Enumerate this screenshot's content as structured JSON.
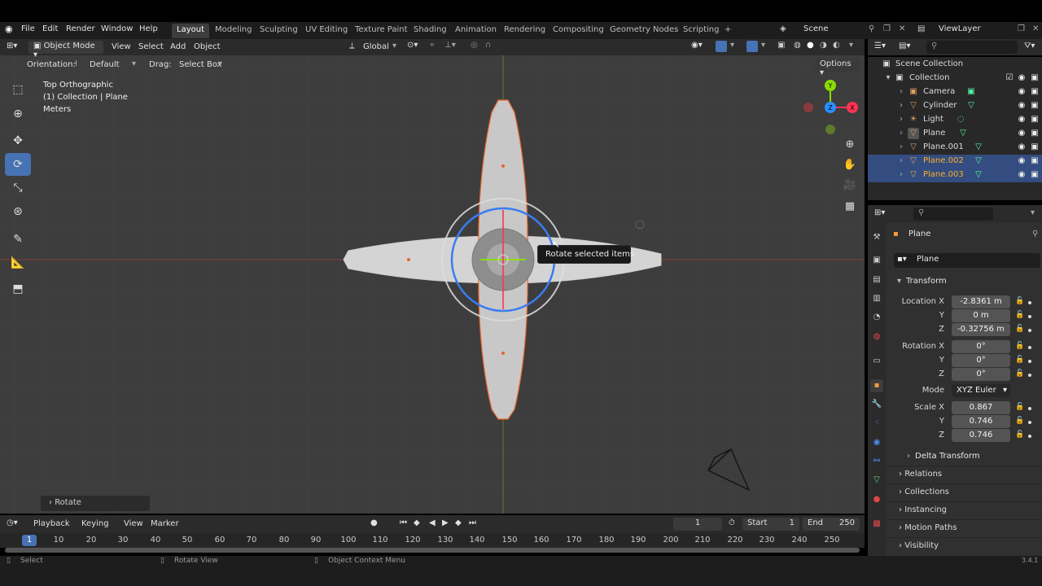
{
  "topbar": {
    "menus": [
      "File",
      "Edit",
      "Render",
      "Window",
      "Help"
    ],
    "workspaces": [
      "Layout",
      "Modeling",
      "Sculpting",
      "UV Editing",
      "Texture Paint",
      "Shading",
      "Animation",
      "Rendering",
      "Compositing",
      "Geometry Nodes",
      "Scripting"
    ],
    "active_workspace": "Layout",
    "add_tab": "+",
    "scene": "Scene",
    "view_layer": "ViewLayer"
  },
  "viewport_header": {
    "mode": "Object Mode",
    "menus": [
      "View",
      "Select",
      "Add",
      "Object"
    ],
    "transform_orientation": "Global"
  },
  "tool_settings": {
    "orientation_label": "Orientation:",
    "orientation_value": "Default",
    "drag_label": "Drag:",
    "drag_value": "Select Box",
    "options": "Options"
  },
  "viewport": {
    "view_name": "Top Orthographic",
    "collection_info": "(1) Collection | Plane",
    "units": "Meters",
    "tooltip": "Rotate selected items",
    "last_operator": "Rotate",
    "gizmo_axes": {
      "x": "X",
      "y": "Y",
      "z": "Z"
    }
  },
  "timeline": {
    "menus": [
      "Playback",
      "Keying",
      "View",
      "Marker"
    ],
    "current_frame": "1",
    "start_label": "Start",
    "start_value": "1",
    "end_label": "End",
    "end_value": "250",
    "ruler_current": "1",
    "ruler_ticks": [
      "10",
      "20",
      "30",
      "40",
      "50",
      "60",
      "70",
      "80",
      "90",
      "100",
      "110",
      "120",
      "130",
      "140",
      "150",
      "160",
      "170",
      "180",
      "190",
      "200",
      "210",
      "220",
      "230",
      "240",
      "250"
    ]
  },
  "statusbar": {
    "select": "Select",
    "rotate_view": "Rotate View",
    "context_menu": "Object Context Menu",
    "version": "3.4.1"
  },
  "outliner": {
    "scene_collection": "Scene Collection",
    "collection": "Collection",
    "items": [
      {
        "name": "Camera",
        "selected": false
      },
      {
        "name": "Cylinder",
        "selected": false
      },
      {
        "name": "Light",
        "selected": false
      },
      {
        "name": "Plane",
        "selected": false
      },
      {
        "name": "Plane.001",
        "selected": false
      },
      {
        "name": "Plane.002",
        "selected": true
      },
      {
        "name": "Plane.003",
        "selected": true
      }
    ]
  },
  "properties": {
    "object_name": "Plane",
    "data_name": "Plane",
    "transform_header": "Transform",
    "location": {
      "label": "Location X",
      "x": "-2.8361 m",
      "y": "0 m",
      "z": "-0.32756 m"
    },
    "rotation": {
      "label": "Rotation X",
      "x": "0°",
      "y": "0°",
      "z": "0°"
    },
    "mode_label": "Mode",
    "mode_value": "XYZ Euler",
    "scale": {
      "label": "Scale X",
      "x": "0.867",
      "y": "0.746",
      "z": "0.746"
    },
    "axis_labels": {
      "y": "Y",
      "z": "Z"
    },
    "delta_transform": "Delta Transform",
    "panels": [
      "Relations",
      "Collections",
      "Instancing",
      "Motion Paths",
      "Visibility"
    ]
  },
  "colors": {
    "selection": "#4772b3",
    "active_object": "#ffaf29",
    "x_axis": "#ff3352",
    "y_axis": "#8bdc00",
    "z_axis": "#2890ff"
  }
}
